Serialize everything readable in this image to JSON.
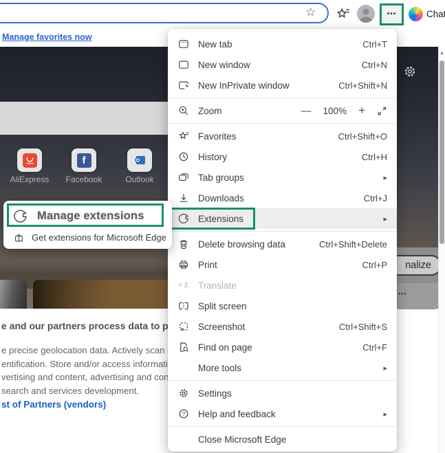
{
  "toolbar": {
    "chat_label": "Chat"
  },
  "favorites_bar": {
    "manage_link": "Manage favorites now"
  },
  "menu": {
    "items": [
      {
        "label": "New tab",
        "shortcut": "Ctrl+T"
      },
      {
        "label": "New window",
        "shortcut": "Ctrl+N"
      },
      {
        "label": "New InPrivate window",
        "shortcut": "Ctrl+Shift+N"
      },
      {
        "label": "Zoom"
      },
      {
        "label": "Favorites",
        "shortcut": "Ctrl+Shift+O"
      },
      {
        "label": "History",
        "shortcut": "Ctrl+H"
      },
      {
        "label": "Tab groups"
      },
      {
        "label": "Downloads",
        "shortcut": "Ctrl+J"
      },
      {
        "label": "Extensions"
      },
      {
        "label": "Delete browsing data",
        "shortcut": "Ctrl+Shift+Delete"
      },
      {
        "label": "Print",
        "shortcut": "Ctrl+P"
      },
      {
        "label": "Translate"
      },
      {
        "label": "Split screen"
      },
      {
        "label": "Screenshot",
        "shortcut": "Ctrl+Shift+S"
      },
      {
        "label": "Find on page",
        "shortcut": "Ctrl+F"
      },
      {
        "label": "More tools"
      },
      {
        "label": "Settings"
      },
      {
        "label": "Help and feedback"
      },
      {
        "label": "Close Microsoft Edge"
      }
    ],
    "zoom_value": "100%"
  },
  "submenu": {
    "manage_label": "Manage extensions",
    "get_label": "Get extensions for Microsoft Edge"
  },
  "page": {
    "tiles": [
      "AliExpress",
      "Facebook",
      "Outlook"
    ],
    "facebook_letter": "f",
    "personalize_button": "nalize",
    "consent_heading": "e and our partners process data to provi",
    "consent_lines": [
      "e precise geolocation data. Actively scan devi",
      "entification. Store and/or access information o",
      "vertising and content, advertising and conten",
      "search and services development."
    ],
    "partners_link": "st of Partners (vendors)"
  },
  "glyphs": {
    "submenu_arrow": "▸",
    "zoom_minus": "—",
    "zoom_plus": "+",
    "scroll_up": "▲",
    "address_star": "☆",
    "dots": "•••"
  },
  "colors": {
    "annotation_green": "#1a8e6b",
    "link_blue": "#2163c4"
  }
}
